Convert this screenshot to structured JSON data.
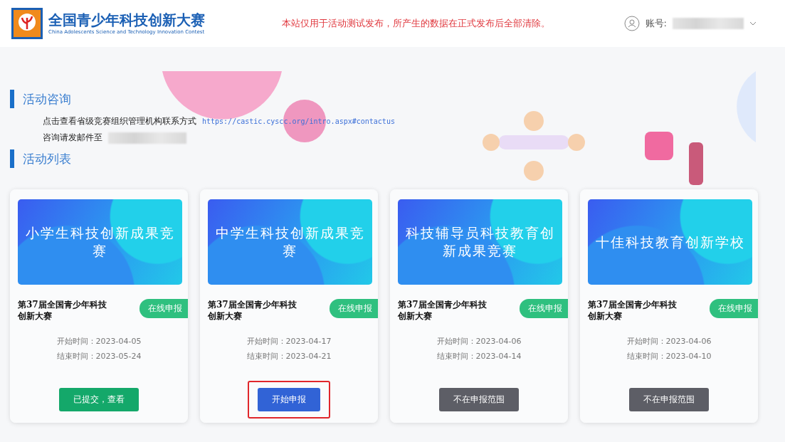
{
  "header": {
    "title": "全国青少年科技创新大赛",
    "subtitle": "China Adolescents Science and Technology Innovation Contest",
    "notice": "本站仅用于活动测试发布，所产生的数据在正式发布后全部清除。",
    "account_label": "账号:"
  },
  "consult": {
    "heading": "活动咨询",
    "contact_text": "点击查看省级竞赛组织管理机构联系方式",
    "contact_link": "https://castic.cyscc.org/intro.aspx#contactus",
    "email_text": "咨询请发邮件至"
  },
  "activities": {
    "heading": "活动列表",
    "cards": [
      {
        "banner": "小学生科技创新成果竞赛",
        "title": "第37届全国青少年科技创新大赛",
        "badge": "在线申报",
        "start": "开始时间：2023-04-05",
        "end": "结束时间：2023-05-24",
        "button": {
          "kind": "submitted",
          "label": "已提交，查看"
        },
        "highlighted": false
      },
      {
        "banner": "中学生科技创新成果竞赛",
        "title": "第37届全国青少年科技创新大赛",
        "badge": "在线申报",
        "start": "开始时间：2023-04-17",
        "end": "结束时间：2023-04-21",
        "button": {
          "kind": "start",
          "label": "开始申报"
        },
        "highlighted": true
      },
      {
        "banner": "科技辅导员科技教育创新成果竞赛",
        "title": "第37届全国青少年科技创新大赛",
        "badge": "在线申报",
        "start": "开始时间：2023-04-06",
        "end": "结束时间：2023-04-14",
        "button": {
          "kind": "closed",
          "label": "不在申报范围"
        },
        "highlighted": false
      },
      {
        "banner": "十佳科技教育创新学校",
        "title": "第37届全国青少年科技创新大赛",
        "badge": "在线申报",
        "start": "开始时间：2023-04-06",
        "end": "结束时间：2023-04-10",
        "button": {
          "kind": "closed",
          "label": "不在申报范围"
        },
        "highlighted": false
      }
    ]
  }
}
